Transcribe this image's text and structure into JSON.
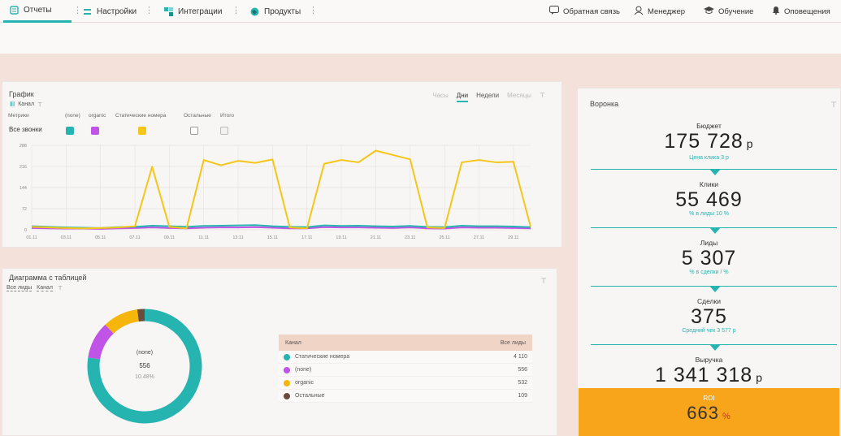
{
  "nav": {
    "left": [
      {
        "label": "Отчеты",
        "icon": "reports-icon",
        "active": true
      },
      {
        "label": "Настройки",
        "icon": "settings-icon",
        "active": false
      },
      {
        "label": "Интеграции",
        "icon": "integrations-icon",
        "active": false
      },
      {
        "label": "Продукты",
        "icon": "products-icon",
        "active": false
      }
    ],
    "right": [
      {
        "label": "Обратная связь",
        "icon": "feedback-icon"
      },
      {
        "label": "Менеджер",
        "icon": "manager-icon"
      },
      {
        "label": "Обучение",
        "icon": "graduation-cap-icon"
      },
      {
        "label": "Оповещения",
        "icon": "bell-icon"
      }
    ]
  },
  "graph": {
    "title": "График",
    "channel_label": "Канал",
    "tabs": [
      "Часы",
      "Дни",
      "Недели",
      "Месяцы"
    ],
    "active_tab": "Дни",
    "legend_header": {
      "metrics": "Метрики",
      "none": "(none)",
      "organic": "organic",
      "static": "Статические номера",
      "other": "Остальные",
      "total": "Итого"
    },
    "row_label": "Все звонки",
    "colors": {
      "none": "#26b4b1",
      "organic": "#c054e6",
      "static": "#f5c518",
      "other": "#6b4b3e"
    }
  },
  "chart_data": {
    "type": "line",
    "x": [
      "01.11",
      "02.11",
      "03.11",
      "04.11",
      "05.11",
      "06.11",
      "07.11",
      "08.11",
      "09.11",
      "10.11",
      "11.11",
      "12.11",
      "13.11",
      "14.11",
      "15.11",
      "16.11",
      "17.11",
      "18.11",
      "19.11",
      "20.11",
      "21.11",
      "22.11",
      "23.11",
      "24.11",
      "25.11",
      "26.11",
      "27.11",
      "28.11",
      "29.11",
      "30.11"
    ],
    "xticks": [
      "01.11",
      "03.11",
      "05.11",
      "07.11",
      "09.11",
      "11.11",
      "13.11",
      "15.11",
      "17.11",
      "19.11",
      "21.11",
      "23.11",
      "25.11",
      "27.11",
      "29.11"
    ],
    "yticks": [
      "0",
      "72",
      "144",
      "216",
      "288"
    ],
    "ylim": [
      0,
      288
    ],
    "series": [
      {
        "name": "Статические номера",
        "color": "#f5c518",
        "values": [
          10,
          8,
          6,
          5,
          6,
          8,
          12,
          215,
          10,
          5,
          238,
          220,
          235,
          228,
          240,
          8,
          5,
          225,
          238,
          230,
          270,
          255,
          240,
          8,
          6,
          230,
          238,
          230,
          232,
          10
        ]
      },
      {
        "name": "(none)",
        "color": "#26b4b1",
        "values": [
          12,
          10,
          8,
          7,
          6,
          9,
          10,
          14,
          12,
          10,
          13,
          14,
          15,
          16,
          12,
          10,
          9,
          15,
          13,
          14,
          12,
          11,
          13,
          10,
          9,
          14,
          12,
          12,
          11,
          9
        ]
      },
      {
        "name": "organic",
        "color": "#c054e6",
        "values": [
          6,
          5,
          4,
          4,
          3,
          5,
          6,
          8,
          6,
          5,
          7,
          8,
          8,
          9,
          7,
          5,
          5,
          9,
          8,
          8,
          7,
          6,
          8,
          5,
          4,
          8,
          7,
          7,
          6,
          5
        ]
      }
    ]
  },
  "donut": {
    "title": "Диаграмма с таблицей",
    "filter1": "Все лиды",
    "filter2": "Канал",
    "center_label": "(none)",
    "center_value": "556",
    "center_pct": "10.48%",
    "table_head": {
      "channel": "Канал",
      "leads": "Все лиды"
    },
    "rows": [
      {
        "label": "Статические номера",
        "value": "4 110",
        "num": 4110,
        "color": "#26b4b1"
      },
      {
        "label": "(none)",
        "value": "556",
        "num": 556,
        "color": "#c054e6"
      },
      {
        "label": "organic",
        "value": "532",
        "num": 532,
        "color": "#f5b50a"
      },
      {
        "label": "Остальные",
        "value": "109",
        "num": 109,
        "color": "#6b4b3e"
      }
    ]
  },
  "funnel": {
    "title": "Воронка",
    "blocks": [
      {
        "label": "Бюджет",
        "value": "175 728",
        "cur": "р",
        "sub": "Цена клика 3 р"
      },
      {
        "label": "Клики",
        "value": "55 469",
        "cur": "",
        "sub": "% в лиды 10 %"
      },
      {
        "label": "Лиды",
        "value": "5 307",
        "cur": "",
        "sub": "% в сделки / %"
      },
      {
        "label": "Сделки",
        "value": "375",
        "cur": "",
        "sub": "Средний чек 3 577 р"
      },
      {
        "label": "Выручка",
        "value": "1 341 318",
        "cur": "р",
        "sub": ""
      }
    ],
    "roi": {
      "label": "ROI",
      "value": "663",
      "cur": "%"
    }
  }
}
